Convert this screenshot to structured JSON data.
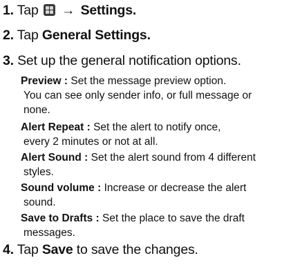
{
  "steps": [
    {
      "num": "1.",
      "prefix": "Tap",
      "icon": "apps-menu-icon",
      "arrow": "→",
      "strong": "Settings."
    },
    {
      "num": "2.",
      "prefix": "Tap",
      "strong": "General Settings."
    },
    {
      "num": "3.",
      "text": "Set up the general notification options."
    },
    {
      "num": "4.",
      "prefix": "Tap",
      "strong": "Save",
      "suffix": "to save the changes."
    }
  ],
  "options": [
    {
      "label": "Preview :",
      "text": "Set the message preview option.",
      "cont": [
        "You can see only sender info, or full message or",
        "none."
      ]
    },
    {
      "label": "Alert Repeat :",
      "text": "Set the alert to notify once,",
      "cont": [
        "every 2 minutes or not at all."
      ]
    },
    {
      "label": "Alert Sound :",
      "text": "Set the alert sound from 4 different",
      "cont": [
        "styles."
      ]
    },
    {
      "label": "Sound volume :",
      "text": "Increase or decrease the alert",
      "cont": [
        "sound."
      ]
    },
    {
      "label": "Save to Drafts :",
      "text": "Set the place to save the draft",
      "cont": [
        "messages."
      ]
    }
  ]
}
